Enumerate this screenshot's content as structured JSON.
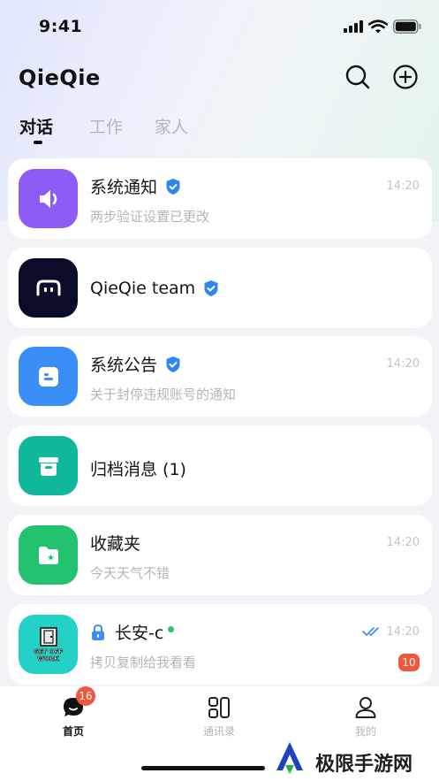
{
  "status_bar": {
    "time": "9:41"
  },
  "header": {
    "brand": "QieQie",
    "search_icon": "search-icon",
    "add_icon": "plus-circle-icon"
  },
  "tabs": [
    {
      "label": "对话",
      "active": true
    },
    {
      "label": "工作",
      "active": false
    },
    {
      "label": "家人",
      "active": false
    }
  ],
  "conversations": [
    {
      "title": "系统通知",
      "subtitle": "两步验证设置已更改",
      "time": "14:20",
      "verified": true,
      "icon": "speaker-icon",
      "color": "#8d5cf6"
    },
    {
      "title": "QieQie team",
      "verified": true,
      "icon": "qieqie-logo-icon",
      "color": "#0b0b2a"
    },
    {
      "title": "系统公告",
      "subtitle": "关于封停违规账号的通知",
      "time": "14:20",
      "verified": true,
      "icon": "chat-bot-icon",
      "color": "#3a8ef6"
    },
    {
      "title": "归档消息 (1)",
      "icon": "archive-box-icon",
      "color": "#11b79a"
    },
    {
      "title": "收藏夹",
      "subtitle": "今天天气不错",
      "time": "14:20",
      "icon": "folder-star-icon",
      "color": "#22c26e"
    },
    {
      "title": "长安-c",
      "subtitle": "拷贝复制给我看看",
      "time": "14:20",
      "badge": "10",
      "online": true,
      "locked": true,
      "read": true,
      "avatar_text": "GET OFF WORK",
      "color": "#23d1c6"
    }
  ],
  "tabbar": [
    {
      "label": "首页",
      "icon": "chat-bubble-icon",
      "badge": "16",
      "active": true
    },
    {
      "label": "通讯录",
      "icon": "contacts-grid-icon",
      "active": false
    },
    {
      "label": "我的",
      "icon": "user-icon",
      "active": false
    }
  ],
  "watermark": {
    "text": "极限手游网"
  }
}
